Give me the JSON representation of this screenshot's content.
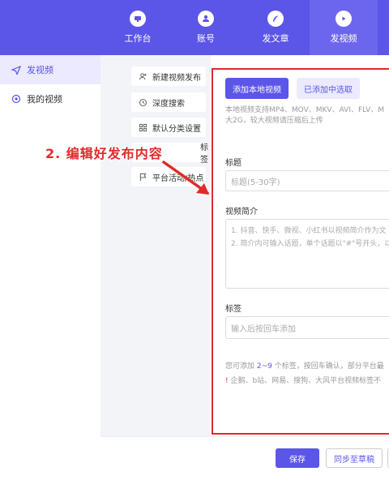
{
  "topnav": {
    "items": [
      {
        "label": "工作台",
        "icon": "monitor-icon"
      },
      {
        "label": "账号",
        "icon": "user-icon"
      },
      {
        "label": "发文章",
        "icon": "feather-icon"
      },
      {
        "label": "发视频",
        "icon": "play-icon",
        "active": true
      }
    ]
  },
  "sidebar": {
    "items": [
      {
        "label": "发视频",
        "icon": "send-icon",
        "active": true
      },
      {
        "label": "我的视频",
        "icon": "target-icon"
      }
    ]
  },
  "options": {
    "items": [
      {
        "label": "新建视频发布",
        "icon": "user-plus-icon"
      },
      {
        "label": "深度搜索",
        "icon": "history-icon"
      },
      {
        "label": "默认分类设置",
        "icon": "grid-icon"
      },
      {
        "label": "标签",
        "icon": "tag-icon"
      },
      {
        "label": "平台活动/热点",
        "icon": "flag-icon"
      }
    ]
  },
  "form": {
    "add_local_label": "添加本地视频",
    "select_added_label": "已添加中选取",
    "format_hint_line1": "本地视频支持MP4、MOV、MKV、AVI、FLV、M",
    "format_hint_line2": "大2G，较大视频请压缩后上传",
    "title_label": "标题",
    "title_placeholder": "标题(5-30字)",
    "desc_label": "视频简介",
    "desc_placeholder_line1": "1. 抖音、快手、微视、小红书以视频简介作为文",
    "desc_placeholder_line2": "2. 简介内可输入话题，单个话题以\"#\"号开头，以",
    "tags_label": "标签",
    "tags_placeholder": "输入后按回车添加",
    "tags_hint_prefix": "您可添加 ",
    "tags_hint_range": "2~9",
    "tags_hint_suffix": " 个标签，按回车确认，部分平台最",
    "tags_warning": "企鹅、b站、网易、搜狗、大风平台视频标签不"
  },
  "bottom": {
    "save_label": "保存",
    "draft_label": "同步至草稿"
  },
  "annotation": {
    "text": "2. 编辑好发布内容"
  },
  "colors": {
    "brand": "#5b55e8",
    "annotation_red": "#e02a2a"
  }
}
